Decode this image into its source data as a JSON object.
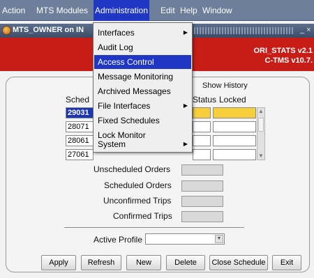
{
  "menubar": {
    "items": [
      {
        "label": "Action"
      },
      {
        "label": "MTS Modules"
      },
      {
        "label": "Administration"
      },
      {
        "label": "Edit"
      },
      {
        "label": "Help"
      },
      {
        "label": "Window"
      }
    ]
  },
  "window": {
    "title": "MTS_OWNER on IN",
    "controls": "_ ×"
  },
  "banner": {
    "line1": "ORI_STATS v2.1",
    "line2": "C-TMS v10.7."
  },
  "dropdown": {
    "items": [
      {
        "label": "Interfaces",
        "submenu": "▶"
      },
      {
        "label": "Audit Log"
      },
      {
        "label": "Access Control"
      },
      {
        "label": "Message Monitoring"
      },
      {
        "label": "Archived Messages"
      },
      {
        "label": "File Interfaces",
        "submenu": "▶"
      },
      {
        "label": "Fixed Schedules"
      },
      {
        "label": "Lock Monitor"
      },
      {
        "label": "System",
        "submenu": "▶"
      }
    ]
  },
  "form": {
    "show_history": "Show History",
    "headers": {
      "schedule": "Sched",
      "status": "Status",
      "locked": "Locked"
    },
    "rows": [
      {
        "schedule": "29031"
      },
      {
        "schedule": "28071"
      },
      {
        "schedule": "28061"
      },
      {
        "schedule": "27061"
      }
    ],
    "summary": [
      {
        "label": "Unscheduled Orders"
      },
      {
        "label": "Scheduled Orders"
      },
      {
        "label": "Unconfirmed Trips"
      },
      {
        "label": "Confirmed Trips"
      }
    ],
    "active_profile_label": "Active Profile",
    "active_profile_value": ""
  },
  "buttons": {
    "apply": "Apply",
    "refresh": "Refresh",
    "new": "New",
    "delete": "Delete",
    "close_schedule": "Close Schedule",
    "exit": "Exit"
  },
  "colors": {
    "menubar": "#6d7f9a",
    "highlight": "#1f37c2",
    "banner": "#c71d16",
    "locked_field": "#f7cf3b"
  }
}
